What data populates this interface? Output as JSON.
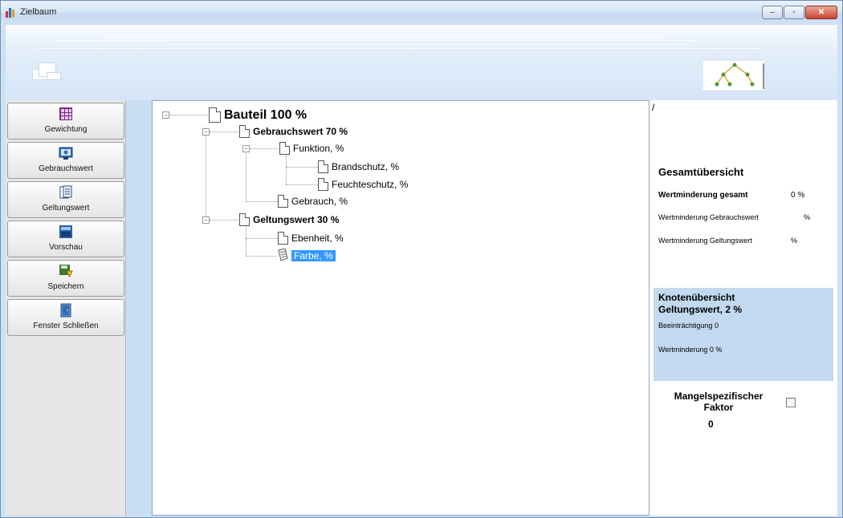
{
  "window": {
    "title": "Zielbaum"
  },
  "sidebar": {
    "items": [
      {
        "label": "Gewichtung"
      },
      {
        "label": "Gebrauchswert"
      },
      {
        "label": "Geltungswert"
      },
      {
        "label": "Vorschau"
      },
      {
        "label": "Speichern"
      },
      {
        "label": "Fenster Schließen"
      }
    ]
  },
  "tree": {
    "root": "Bauteil 100 %",
    "gebrauchswert": "Gebrauchswert  70 %",
    "funktion": "Funktion,  %",
    "brandschutz": "Brandschutz,  %",
    "feuchteschutz": "Feuchteschutz,  %",
    "gebrauch": "Gebrauch,  %",
    "geltungswert": "Geltungswert  30 %",
    "ebenheit": "Ebenheit,  %",
    "farbe": "Farbe,  %"
  },
  "summary": {
    "marker": "/",
    "title": "Gesamtübersicht",
    "total_label": "Wertminderung gesamt",
    "total_value": "0 %",
    "gebrauch_label": "Wertminderung Gebrauchswert",
    "gebrauch_value": "%",
    "geltung_label": "Wertminderung Geltungswert",
    "geltung_value": "%"
  },
  "node_overview": {
    "title": "Knotenübersicht",
    "node": "Geltungswert, 2  %",
    "beeintraechtigung": "Beeinträchtigung  0",
    "wertminderung": "Wertminderung  0 %"
  },
  "mangel": {
    "label_line1": "Mangelspezifischer",
    "label_line2": "Faktor",
    "value": "0"
  },
  "colors": {
    "accent": "#3399ff",
    "panel_blue": "#c2d9f0"
  }
}
